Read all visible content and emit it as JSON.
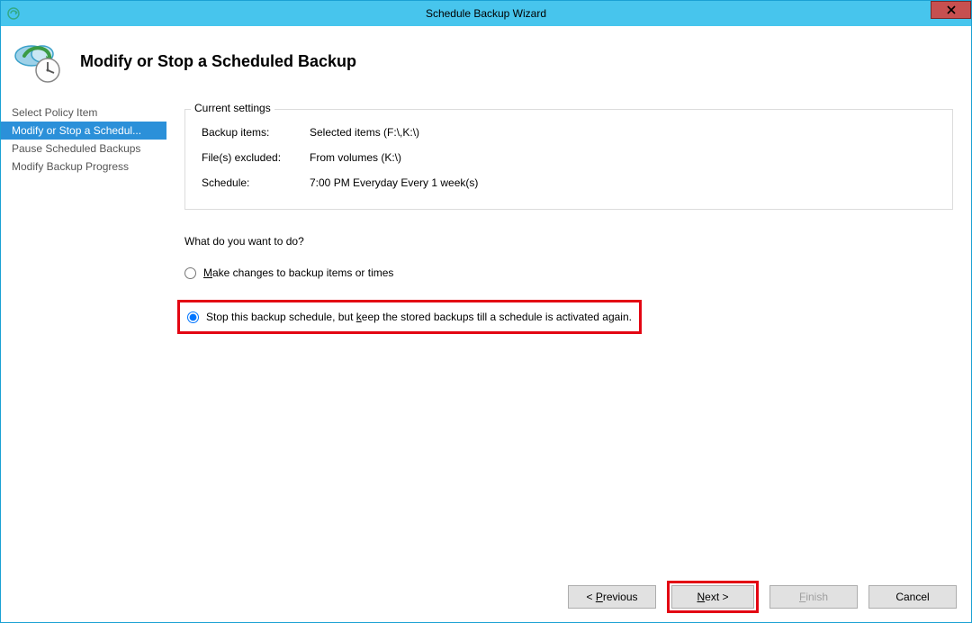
{
  "window": {
    "title": "Schedule Backup Wizard",
    "close_label": "x"
  },
  "header": {
    "title": "Modify or Stop a Scheduled Backup"
  },
  "sidebar": {
    "items": [
      {
        "label": "Select Policy Item",
        "active": false
      },
      {
        "label": "Modify or Stop a Schedul...",
        "active": true
      },
      {
        "label": "Pause Scheduled Backups",
        "active": false
      },
      {
        "label": "Modify Backup Progress",
        "active": false
      }
    ]
  },
  "group": {
    "legend": "Current settings",
    "rows": [
      {
        "label": "Backup items:",
        "value": "Selected items (F:\\,K:\\)"
      },
      {
        "label": "File(s) excluded:",
        "value": "From volumes (K:\\)"
      },
      {
        "label": "Schedule:",
        "value": "7:00 PM Everyday Every 1 week(s)"
      }
    ]
  },
  "prompt": "What do you want to do?",
  "options": {
    "make_changes_pre": "M",
    "make_changes_post": "ake changes to backup items or times",
    "stop_pre": "Stop this backup schedule, but ",
    "stop_key": "k",
    "stop_post": "eep the stored backups till a schedule is activated again."
  },
  "buttons": {
    "previous_pre": "< ",
    "previous_key": "P",
    "previous_post": "revious",
    "next_key": "N",
    "next_post": "ext >",
    "finish_key": "F",
    "finish_post": "inish",
    "cancel": "Cancel"
  }
}
